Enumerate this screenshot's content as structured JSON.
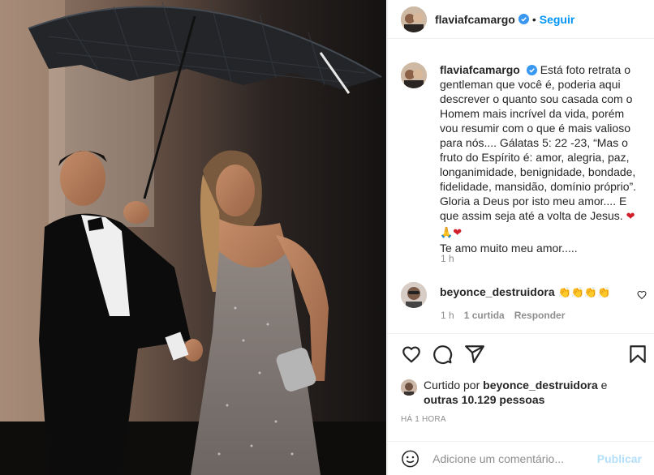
{
  "post": {
    "username": "flaviafcamargo",
    "follow_label": "Seguir",
    "dot": "•",
    "photo_icon": "wedding-couple-umbrella-photo"
  },
  "caption": {
    "username": "flaviafcamargo",
    "text": "Está foto retrata o gentleman que você é, poderia aqui descrever o quanto sou casada com o Homem mais incrível da vida, porém vou resumir com o que é mais valioso para nós.... Gálatas 5: 22 -23, “Mas o fruto do Espírito é: amor, alegria, paz, longanimidade, benignidade, bondade, fidelidade, mansidão, domínio próprio”. Gloria a Deus por isto meu amor.... E que assim seja até a volta de Jesus. ",
    "emoji_heart": "❤",
    "emoji_hands": "🙏",
    "text_end": "Te amo muito meu amor.....",
    "time": "1 h"
  },
  "comment": {
    "username": "beyonce_destruidora",
    "text": "👏👏👏👏",
    "time": "1 h",
    "likes": "1 curtida",
    "reply_label": "Responder"
  },
  "likes": {
    "prefix": "Curtido por ",
    "user": "beyonce_destruidora",
    "middle": " e",
    "others": "outras 10.129 pessoas"
  },
  "posted_time": "HÁ 1 HORA",
  "comment_box": {
    "placeholder": "Adicione um comentário...",
    "publish_label": "Publicar"
  },
  "colors": {
    "accent": "#0095f6",
    "publish_disabled": "#b2dffc",
    "muted": "#8e8e8e",
    "verified": "#3897f0",
    "heart": "#d11c2a"
  }
}
